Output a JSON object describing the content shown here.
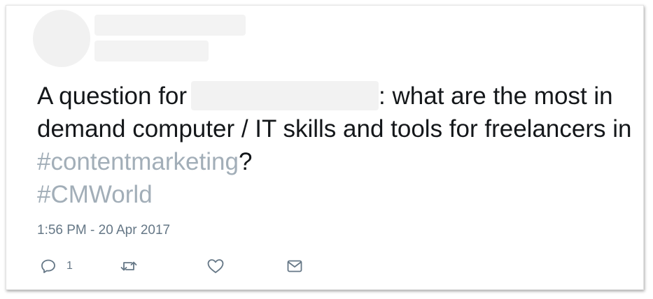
{
  "tweet": {
    "text_before": "A question for",
    "text_after": ": what are the most in demand computer / IT skills and tools for freelancers in ",
    "hashtag_1": "#contentmarketing",
    "punct": "?",
    "hashtag_2": "#CMWorld",
    "timestamp": "1:56 PM - 20 Apr 2017"
  },
  "actions": {
    "reply_count": "1",
    "reply_icon": "speech-bubble-icon",
    "retweet_icon": "retweet-arrows-icon",
    "like_icon": "heart-icon",
    "dm_icon": "envelope-icon"
  },
  "colors": {
    "text": "#14171a",
    "hashtag": "#a2aeb8",
    "meta": "#657786",
    "placeholder": "#f2f2f2"
  }
}
